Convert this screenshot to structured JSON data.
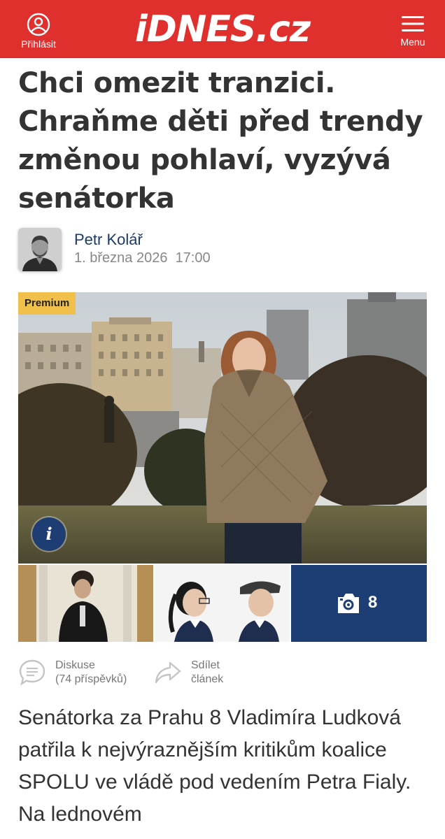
{
  "header": {
    "login_label": "Přihlásit",
    "logo_text": "iDNES.cz",
    "menu_label": "Menu",
    "brand_color": "#e0302e"
  },
  "article": {
    "headline": "Chci omezit tranzici. Chraňme děti před trendy změnou pohlaví, vyzývá senátorka",
    "author": {
      "name": "Petr Kolář",
      "date": "1. března 2026",
      "time": "17:00"
    },
    "premium_badge": "Premium",
    "gallery_count": "8",
    "actions": {
      "discussion_label": "Diskuse",
      "discussion_count": "(74 příspěvků)",
      "share_label": "Sdílet",
      "share_sub": "článek"
    },
    "perex": "Senátorka za Prahu 8 Vladimíra Ludková patřila k nejvýraznějším kritikům koalice SPOLU ve vládě pod vedením Petra Fialy. Na lednovém"
  },
  "icons": {
    "login": "user-circle-icon",
    "menu": "hamburger-icon",
    "info": "info-icon",
    "gallery": "camera-icon",
    "discussion": "speech-bubble-icon",
    "share": "share-arrow-icon"
  },
  "colors": {
    "premium": "#f1c04a",
    "info_button": "#1e3d73",
    "gallery_tile": "#1d3d75",
    "author_name": "#1b3a6b"
  }
}
